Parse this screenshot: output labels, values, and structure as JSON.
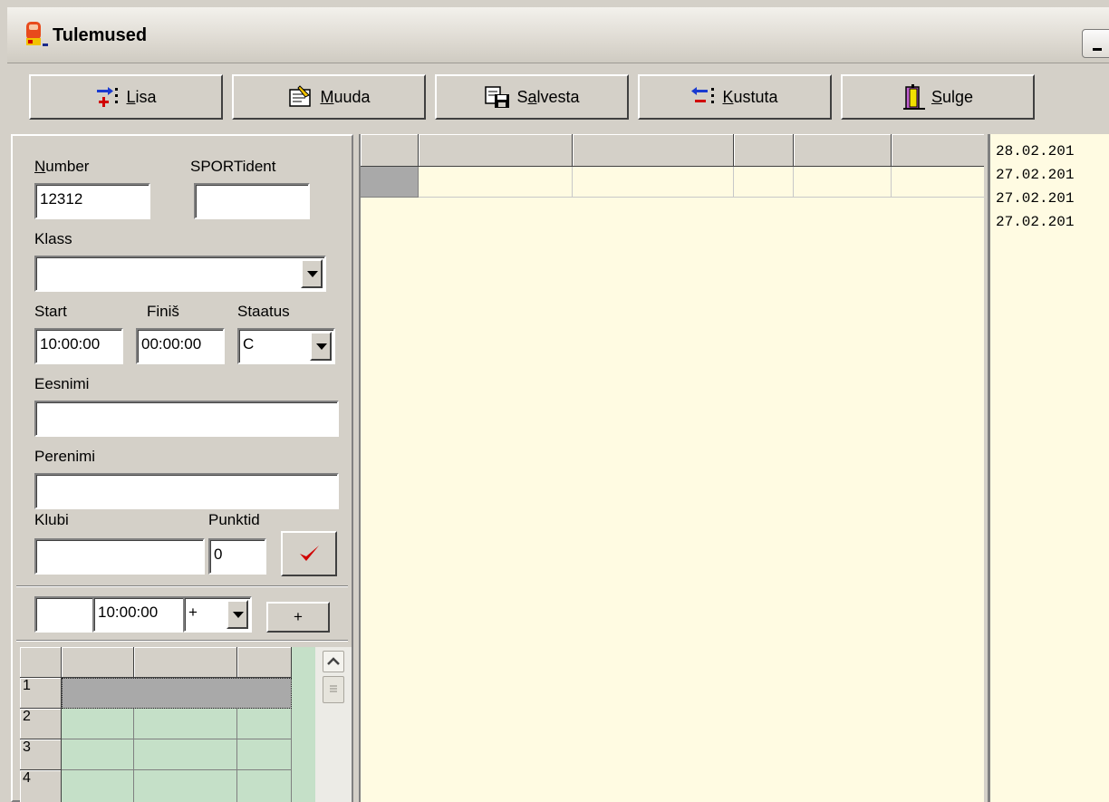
{
  "window": {
    "title": "Tulemused",
    "colors": {
      "face": "#d4d0c8",
      "list_bg": "#fffbe2",
      "grid_bg": "#c5e0c8",
      "confirm_check": "#d00000"
    }
  },
  "toolbar": {
    "buttons": [
      {
        "underline": "L",
        "rest": "isa",
        "icon": "add-record-icon"
      },
      {
        "underline": "M",
        "rest": "uuda",
        "icon": "edit-record-icon"
      },
      {
        "underline": "",
        "prefix": "S",
        "mid": "a",
        "rest": "lvesta",
        "icon": "save-icon"
      },
      {
        "underline": "K",
        "rest": "ustuta",
        "icon": "delete-record-icon"
      },
      {
        "underline": "S",
        "rest": "ulge",
        "icon": "door-exit-icon"
      }
    ]
  },
  "form": {
    "number_label_u": "N",
    "number_label_rest": "umber",
    "number_value": "12312",
    "sportident_label": "SPORTident",
    "sportident_value": "",
    "klass_label": "Klass",
    "klass_value": "",
    "start_label": "Start",
    "start_value": "10:00:00",
    "finish_label": "Finiš",
    "finish_value": "00:00:00",
    "status_label": "Staatus",
    "status_value": "C",
    "eesnimi_label": "Eesnimi",
    "eesnimi_value": "",
    "perenimi_label": "Perenimi",
    "perenimi_value": "",
    "klubi_label": "Klubi",
    "klubi_value": "",
    "punktid_label": "Punktid",
    "punktid_value": "0"
  },
  "adjust": {
    "first_value": "",
    "time_value": "10:00:00",
    "sign_value": "+",
    "add_button_label": "+"
  },
  "left_grid": {
    "row_numbers": [
      "1",
      "2",
      "3",
      "4"
    ]
  },
  "log_list": {
    "entries": [
      "28.02.201",
      "27.02.201",
      "27.02.201",
      "27.02.201"
    ]
  }
}
